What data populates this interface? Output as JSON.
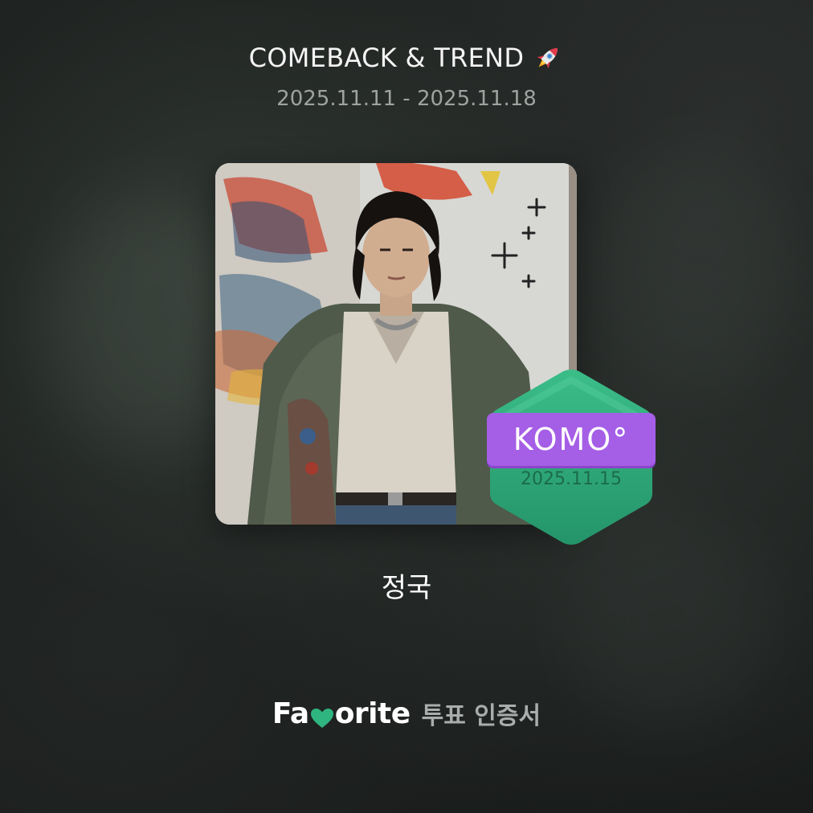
{
  "header": {
    "title": "COMEBACK & TREND",
    "title_icon": "rocket-icon",
    "date_range": "2025.11.11 - 2025.11.18"
  },
  "photo": {
    "description_icon": "artist-photo"
  },
  "badge": {
    "brand": "KOMO°",
    "date": "2025.11.15",
    "colors": {
      "hexagon": "#2fa77a",
      "banner": "#a55ee6",
      "date_text": "#1b6b4c"
    }
  },
  "artist": {
    "name": "정국"
  },
  "footer": {
    "brand_prefix": "Fa",
    "brand_suffix": "orite",
    "brand_icon": "heart-icon",
    "label": "투표 인증서",
    "accent": "#2fb57f"
  }
}
